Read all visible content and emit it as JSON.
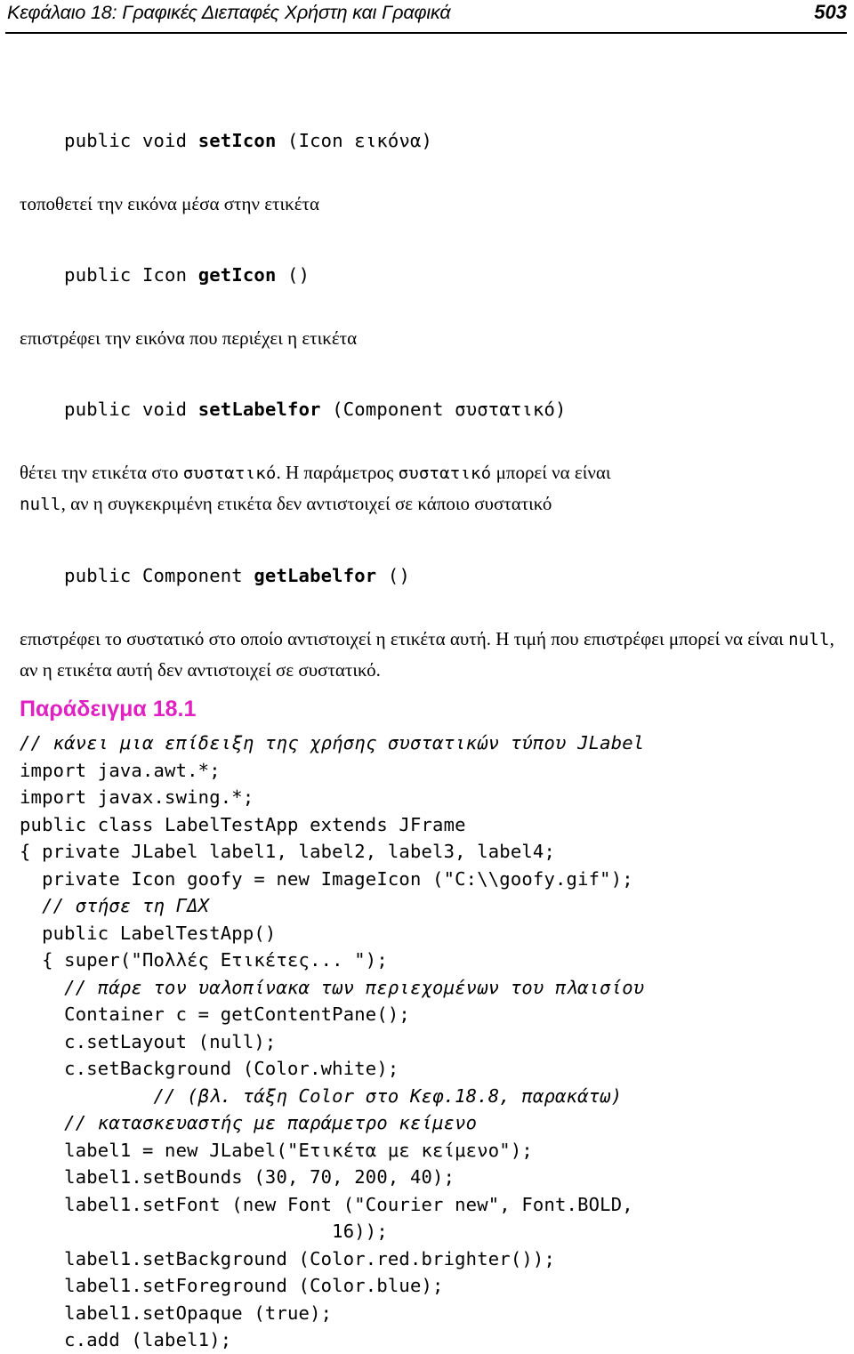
{
  "header": {
    "title": "Κεφάλαιο 18: Γραφικές Διεπαφές Χρήστη και Γραφικά",
    "page_number": "503"
  },
  "accent_color": "#e020c0",
  "api": {
    "entries": [
      {
        "sig_pre": "public void ",
        "sig_name": "setIcon",
        "sig_post": " (Icon εικόνα)",
        "desc": "τοποθετεί την εικόνα μέσα στην ετικέτα"
      },
      {
        "sig_pre": "public Icon ",
        "sig_name": "getIcon",
        "sig_post": " ()",
        "desc": "επιστρέφει την εικόνα που περιέχει η ετικέτα"
      },
      {
        "sig_pre": "public void ",
        "sig_name": "setLabelfor",
        "sig_post": " (Component συστατικό)",
        "desc": "θέτει την ετικέτα στο συστατικό. Η παράμετρος συστατικό μπορεί να είναι null, αν η συγκεκριμένη ετικέτα δεν αντιστοιχεί σε κάποιο συστατικό"
      },
      {
        "sig_pre": "public Component ",
        "sig_name": "getLabelfor",
        "sig_post": " ()",
        "desc": "επιστρέφει το συστατικό στο οποίο αντιστοιχεί η ετικέτα αυτή. Η τιμή που επιστρέφει μπορεί να είναι null, αν η ετικέτα αυτή δεν αντιστοιχεί σε συστατικό."
      }
    ],
    "desc_3_parts": [
      {
        "text": "θέτει την ετικέτα στο ",
        "mono": false
      },
      {
        "text": "συστατικό",
        "mono": true
      },
      {
        "text": ". Η παράμετρος ",
        "mono": false
      },
      {
        "text": "συστατικό",
        "mono": true
      },
      {
        "text": " μπορεί να είναι\n",
        "mono": false
      },
      {
        "text": "null",
        "mono": true
      },
      {
        "text": ", αν η συγκεκριμένη ετικέτα δεν αντιστοιχεί σε κάποιο συστατικό",
        "mono": false
      }
    ],
    "desc_4_parts": [
      {
        "text": "επιστρέφει το συστατικό στο οποίο αντιστοιχεί η ετικέτα αυτή. Η τιμή που επιστρέφει μπορεί να είναι ",
        "mono": false
      },
      {
        "text": "null",
        "mono": true
      },
      {
        "text": ", αν η ετικέτα αυτή δεν αντιστοιχεί σε συστατικό.",
        "mono": false
      }
    ]
  },
  "example": {
    "heading": "Παράδειγμα 18.1",
    "code_lines": [
      {
        "text": "// κάνει μια επίδειξη της χρήσης συστατικών τύπου JLabel",
        "comment": true
      },
      {
        "text": "import java.awt.*;",
        "comment": false
      },
      {
        "text": "import javax.swing.*;",
        "comment": false
      },
      {
        "text": "public class LabelTestApp extends JFrame",
        "comment": false
      },
      {
        "text": "{ private JLabel label1, label2, label3, label4;",
        "comment": false
      },
      {
        "text": "  private Icon goofy = new ImageIcon (\"C:\\\\goofy.gif\");",
        "comment": false
      },
      {
        "text": "  // στήσε τη ΓΔΧ",
        "comment": true
      },
      {
        "text": "  public LabelTestApp()",
        "comment": false
      },
      {
        "text": "  { super(\"Πολλές Ετικέτες... \");",
        "comment": false
      },
      {
        "text": "    // πάρε τον υαλοπίνακα των περιεχομένων του πλαισίου",
        "comment": true
      },
      {
        "text": "    Container c = getContentPane();",
        "comment": false
      },
      {
        "text": "    c.setLayout (null);",
        "comment": false
      },
      {
        "text": "    c.setBackground (Color.white);",
        "comment": false
      },
      {
        "text": "            // (βλ. τάξη Color στο Κεφ.18.8, παρακάτω)",
        "comment": true
      },
      {
        "text": "    // κατασκευαστής με παράμετρο κείμενο",
        "comment": true
      },
      {
        "text": "    label1 = new JLabel(\"Ετικέτα με κείμενο\");",
        "comment": false
      },
      {
        "text": "    label1.setBounds (30, 70, 200, 40);",
        "comment": false
      },
      {
        "text": "    label1.setFont (new Font (\"Courier new\", Font.BOLD,",
        "comment": false
      },
      {
        "text": "                            16));",
        "comment": false
      },
      {
        "text": "    label1.setBackground (Color.red.brighter());",
        "comment": false
      },
      {
        "text": "    label1.setForeground (Color.blue);",
        "comment": false
      },
      {
        "text": "    label1.setOpaque (true);",
        "comment": false
      },
      {
        "text": "    c.add (label1);",
        "comment": false
      }
    ]
  }
}
